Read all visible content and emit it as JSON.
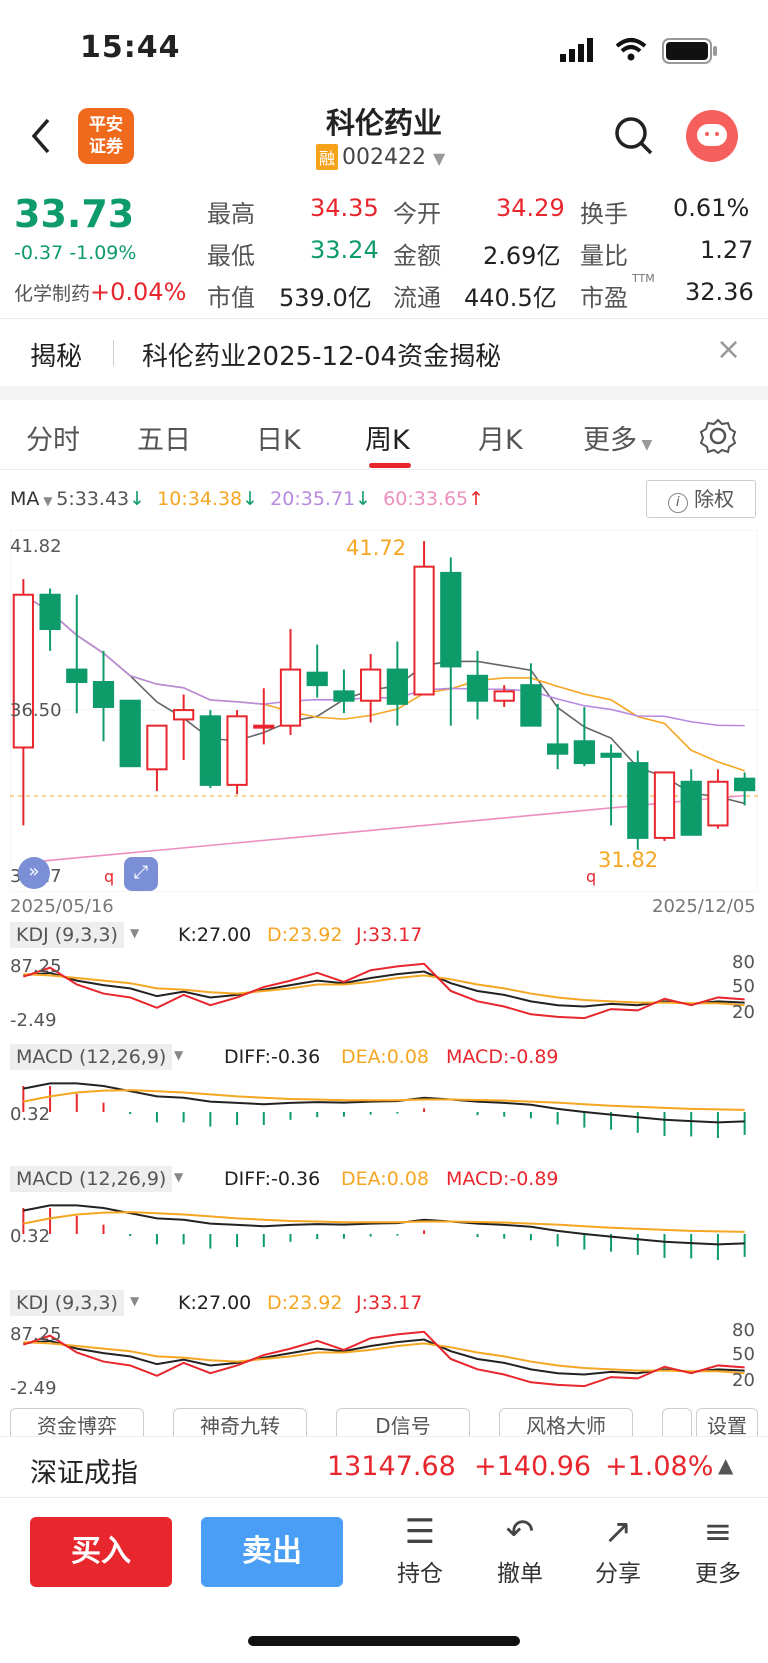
{
  "status": {
    "time": "15:44"
  },
  "header": {
    "title": "科伦药业",
    "rong": "融",
    "code": "002422",
    "logo_line1": "平安",
    "logo_line2": "证券"
  },
  "quote": {
    "price": "33.73",
    "change": "-0.37",
    "change_pct": "-1.09%",
    "sector": "化学制药",
    "sector_change": "+0.04%",
    "high_label": "最高",
    "high": "34.35",
    "open_label": "今开",
    "open": "34.29",
    "turnover_label": "换手",
    "turnover": "0.61%",
    "low_label": "最低",
    "low": "33.24",
    "amount_label": "金额",
    "amount": "2.69亿",
    "vol_ratio_label": "量比",
    "vol_ratio": "1.27",
    "mcap_label": "市值",
    "mcap": "539.0亿",
    "float_label": "流通",
    "float": "440.5亿",
    "pe_label": "市盈",
    "pe_sup": "TTM",
    "pe": "32.36"
  },
  "banner": {
    "tag": "揭秘",
    "text": "科伦药业2025-12-04资金揭秘"
  },
  "tabs": [
    "分时",
    "五日",
    "日K",
    "周K",
    "月K",
    "更多"
  ],
  "ma": {
    "label": "MA",
    "ma5": "5:33.43",
    "ma10": "10:34.38",
    "ma20": "20:35.71",
    "ma60": "60:33.65",
    "adjust": "除权"
  },
  "kchart": {
    "top": "41.82",
    "mid": "36.50",
    "bottom": "31.17",
    "high_mark": "41.72",
    "low_mark": "31.82",
    "date_start": "2025/05/16",
    "date_end": "2025/12/05"
  },
  "kdj": {
    "label": "KDJ (9,3,3)",
    "k": "K:27.00",
    "d": "D:23.92",
    "j": "J:33.17",
    "top": "87.25",
    "bottom": "-2.49",
    "l80": "80",
    "l50": "50",
    "l20": "20"
  },
  "macd": {
    "label": "MACD (12,26,9)",
    "diff": "DIFF:-0.36",
    "dea": "DEA:0.08",
    "macd": "MACD:-0.89",
    "ref": "0.32"
  },
  "pills": [
    "资金博弈",
    "神奇九转",
    "D信号",
    "风格大师",
    "",
    "设置"
  ],
  "index": {
    "name": "深证成指",
    "value": "13147.68",
    "change": "+140.96",
    "pct": "+1.08%"
  },
  "actions": {
    "buy": "买入",
    "sell": "卖出",
    "hold": "持仓",
    "cancel": "撤单",
    "share": "分享",
    "more": "更多"
  },
  "colors": {
    "up": "#e8262d",
    "down": "#0e9b6a",
    "ma5": "#666666",
    "ma10": "#f5a623",
    "ma20": "#b88be0",
    "ma60": "#ec8fbf"
  },
  "chart_data": {
    "type": "candlestick",
    "x_range": [
      "2025/05/16",
      "2025/12/05"
    ],
    "ylim": [
      31.17,
      41.82
    ],
    "candles": [
      {
        "o": 35.1,
        "h": 40.5,
        "l": 32.6,
        "c": 40.0
      },
      {
        "o": 40.0,
        "h": 40.2,
        "l": 38.2,
        "c": 38.9
      },
      {
        "o": 37.6,
        "h": 40.0,
        "l": 36.2,
        "c": 37.2
      },
      {
        "o": 37.2,
        "h": 38.2,
        "l": 35.3,
        "c": 36.4
      },
      {
        "o": 36.6,
        "h": 36.6,
        "l": 34.5,
        "c": 34.5
      },
      {
        "o": 34.4,
        "h": 35.8,
        "l": 33.7,
        "c": 35.8
      },
      {
        "o": 36.0,
        "h": 36.8,
        "l": 34.7,
        "c": 36.3
      },
      {
        "o": 36.1,
        "h": 36.3,
        "l": 33.8,
        "c": 33.9
      },
      {
        "o": 33.9,
        "h": 36.3,
        "l": 33.6,
        "c": 36.1
      },
      {
        "o": 35.8,
        "h": 37.0,
        "l": 35.2,
        "c": 35.8
      },
      {
        "o": 35.8,
        "h": 38.9,
        "l": 35.5,
        "c": 37.6
      },
      {
        "o": 37.5,
        "h": 38.4,
        "l": 36.7,
        "c": 37.1
      },
      {
        "o": 36.9,
        "h": 37.6,
        "l": 36.2,
        "c": 36.6
      },
      {
        "o": 36.6,
        "h": 38.1,
        "l": 35.9,
        "c": 37.6
      },
      {
        "o": 37.6,
        "h": 38.5,
        "l": 35.8,
        "c": 36.5
      },
      {
        "o": 36.8,
        "h": 41.72,
        "l": 36.8,
        "c": 40.9
      },
      {
        "o": 40.7,
        "h": 41.2,
        "l": 35.8,
        "c": 37.7
      },
      {
        "o": 37.4,
        "h": 38.2,
        "l": 36.0,
        "c": 36.6
      },
      {
        "o": 36.6,
        "h": 37.1,
        "l": 36.4,
        "c": 36.9
      },
      {
        "o": 37.1,
        "h": 37.8,
        "l": 35.8,
        "c": 35.8
      },
      {
        "o": 35.2,
        "h": 36.5,
        "l": 34.4,
        "c": 34.9
      },
      {
        "o": 35.3,
        "h": 36.4,
        "l": 34.5,
        "c": 34.6
      },
      {
        "o": 34.9,
        "h": 35.2,
        "l": 32.6,
        "c": 34.8
      },
      {
        "o": 34.6,
        "h": 35.0,
        "l": 31.82,
        "c": 32.2
      },
      {
        "o": 32.2,
        "h": 34.3,
        "l": 32.1,
        "c": 34.3
      },
      {
        "o": 34.0,
        "h": 34.4,
        "l": 32.3,
        "c": 32.3
      },
      {
        "o": 32.6,
        "h": 34.4,
        "l": 32.5,
        "c": 34.0
      },
      {
        "o": 34.1,
        "h": 34.3,
        "l": 33.24,
        "c": 33.73
      }
    ]
  }
}
